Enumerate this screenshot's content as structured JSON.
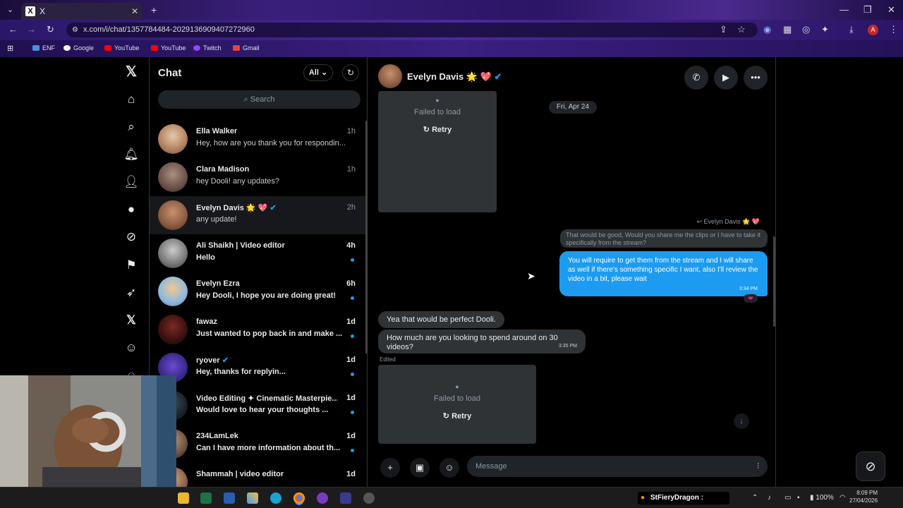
{
  "browser": {
    "tab_title": "X",
    "tab_favicon": "X",
    "url": "x.com/i/chat/1357784484-2029136909407272960",
    "bookmarks": [
      "ENF",
      "Google",
      "YouTube",
      "YouTube",
      "Twitch",
      "Gmail"
    ]
  },
  "chatlist": {
    "title": "Chat",
    "filter_label": "All",
    "search_placeholder": "Search",
    "conversations": [
      {
        "name": "Ella Walker",
        "preview": "Hey, how are you thank you for respondin...",
        "time": "1h",
        "unread": false
      },
      {
        "name": "Clara Madison",
        "preview": "hey Dooli! any updates?",
        "time": "1h",
        "unread": false
      },
      {
        "name": "Evelyn Davis 🌟 💖",
        "preview": "any update!",
        "time": "2h",
        "unread": false
      },
      {
        "name": "Ali Shaikh | Video editor",
        "preview": "Hello",
        "time": "4h",
        "unread": true
      },
      {
        "name": "Evelyn Ezra",
        "preview": "Hey Dooli, I hope you are doing great!",
        "time": "6h",
        "unread": true
      },
      {
        "name": "fawaz",
        "preview": "Just wanted to pop back in and make ...",
        "time": "1d",
        "unread": true
      },
      {
        "name": "ryover",
        "preview": "Hey, thanks for replyin...",
        "time": "1d",
        "unread": true
      },
      {
        "name": "Video Editing ✦ Cinematic Masterpie...",
        "preview": "Would love to hear your thoughts ...",
        "time": "1d",
        "unread": true
      },
      {
        "name": "234LamLek",
        "preview": "Can I have more information about th...",
        "time": "1d",
        "unread": true
      },
      {
        "name": "Shammah | video editor",
        "preview": "",
        "time": "1d",
        "unread": false
      }
    ]
  },
  "conversation": {
    "contact_name": "Evelyn Davis 🌟 💖",
    "date_divider": "Fri, Apr 24",
    "failed_label": "Failed to load",
    "retry_label": "Retry",
    "reply_to": "↩ Evelyn Davis 🌟 💖",
    "quoted_text": "That would be good, Would you share me the clips or I have to take it specifically from the stream?",
    "my_message": "You will require to get them from the stream and I will share as well if there's something specific I want, also I'll review the video in a bit, please wait",
    "my_message_time": "3:34 PM",
    "reaction": "❤",
    "their_message_1": "Yea that would be perfect Dooli.",
    "their_message_2": "How much are you looking to spend around on 30 videos?",
    "their_message_2_time": "3:35 PM",
    "edited_label": "Edited",
    "composer_placeholder": "Message"
  },
  "taskbar": {
    "stream_label": "StFieryDragon :",
    "battery": "100%",
    "clock_time": "8:09 PM",
    "clock_date": "27/04/2026"
  },
  "colors": {
    "accent": "#1d9bf0",
    "bubble": "#2f3336",
    "heart": "#f91880"
  }
}
